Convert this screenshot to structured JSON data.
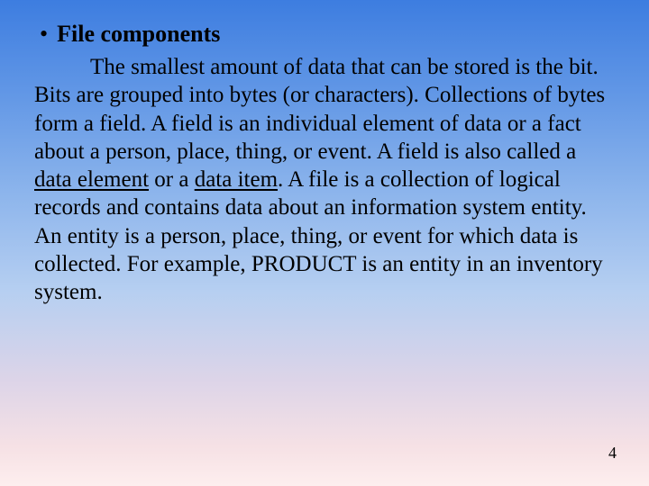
{
  "heading": "File components",
  "body": {
    "p1": "The smallest amount of data that can be stored is the bit. Bits are grouped into bytes (or characters). Collections of bytes form a field. A field is an individual element of data or a fact about a person, place, thing, or event. A field is also called a ",
    "u1": "data element",
    "p2": " or a ",
    "u2": "data item",
    "p3": ". A file is a collection of logical records and contains data about an information system entity. An entity is a person, place, thing, or event for which data is collected. For example, PRODUCT is an entity in an inventory system."
  },
  "page_number": "4"
}
